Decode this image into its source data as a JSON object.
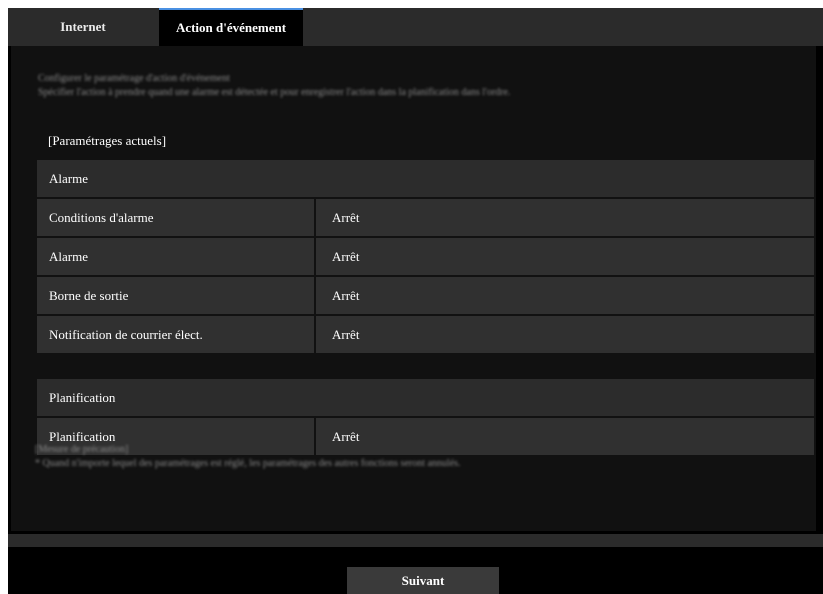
{
  "tabs": [
    {
      "label": "Internet",
      "active": false
    },
    {
      "label": "Action d'événement",
      "active": true
    }
  ],
  "intro": {
    "line1": "Configurer le paramétrage d'action d'événement",
    "line2": "Spécifier l'action à prendre quand une alarme est détectée et pour enregistrer l'action dans la planification dans l'ordre."
  },
  "current_settings_caption": "[Paramétrages actuels]",
  "alarm_section": {
    "title": "Alarme",
    "rows": [
      {
        "label": "Conditions d'alarme",
        "value": "Arrêt"
      },
      {
        "label": "Alarme",
        "value": "Arrêt"
      },
      {
        "label": "Borne de sortie",
        "value": "Arrêt"
      },
      {
        "label": "Notification de courrier élect.",
        "value": "Arrêt"
      }
    ]
  },
  "schedule_section": {
    "title": "Planification",
    "rows": [
      {
        "label": "Planification",
        "value": "Arrêt"
      }
    ]
  },
  "notes": {
    "title": "[Mesure de précaution]",
    "line1": "* Quand n'importe lequel des paramétrages est réglé, les paramétrages des autres fonctions seront annulés."
  },
  "next_button": "Suivant",
  "colors": {
    "background": "#000000",
    "cell": "#303030",
    "tabbar": "#2b2b2b"
  }
}
